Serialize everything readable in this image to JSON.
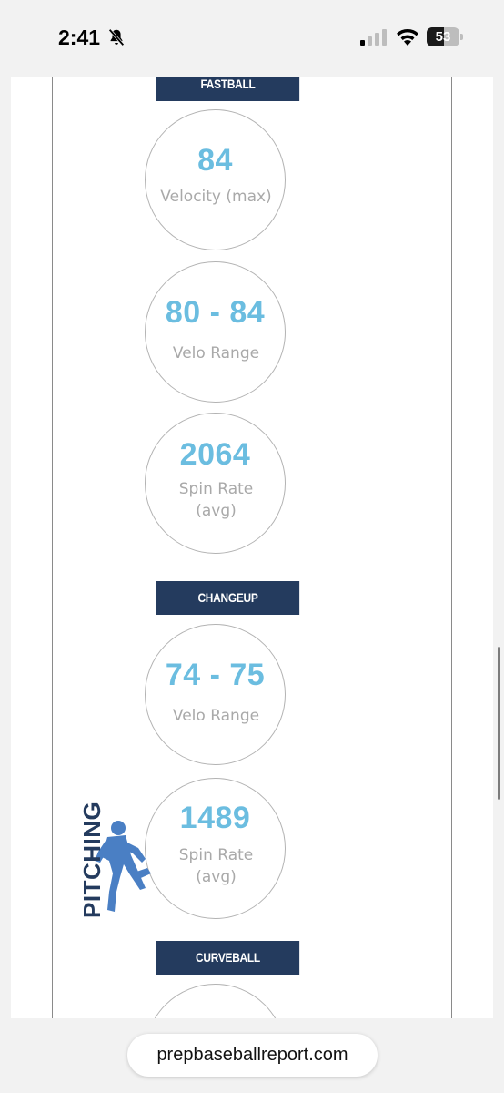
{
  "status_bar": {
    "time": "2:41",
    "icons": [
      "bell-slash-icon",
      "cellular-signal-icon",
      "wifi-icon",
      "battery-icon"
    ],
    "battery_level": "53",
    "battery_fill_fraction": 0.53
  },
  "sections": {
    "fastball": "FASTBALL",
    "changeup": "CHANGEUP",
    "curveball": "CURVEBALL"
  },
  "fastball": {
    "velocity_max": {
      "value": "84",
      "label": "Velocity (max)"
    },
    "velo_range": {
      "value": "80 - 84",
      "label": "Velo Range"
    },
    "spin_rate": {
      "value": "2064",
      "label": "Spin Rate (avg)"
    }
  },
  "changeup": {
    "velo_range": {
      "value": "74 - 75",
      "label": "Velo Range"
    },
    "spin_rate": {
      "value": "1489",
      "label": "Spin Rate (avg)"
    }
  },
  "logo": {
    "text": "PITCHING",
    "icon": "pitcher-silhouette-icon"
  },
  "browser": {
    "url": "prepbaseballreport.com"
  },
  "colors": {
    "header_bg": "#243b5e",
    "stat_value": "#6bbde0",
    "stat_label": "#a9a9a9",
    "logo_blue": "#4a7fc4"
  }
}
